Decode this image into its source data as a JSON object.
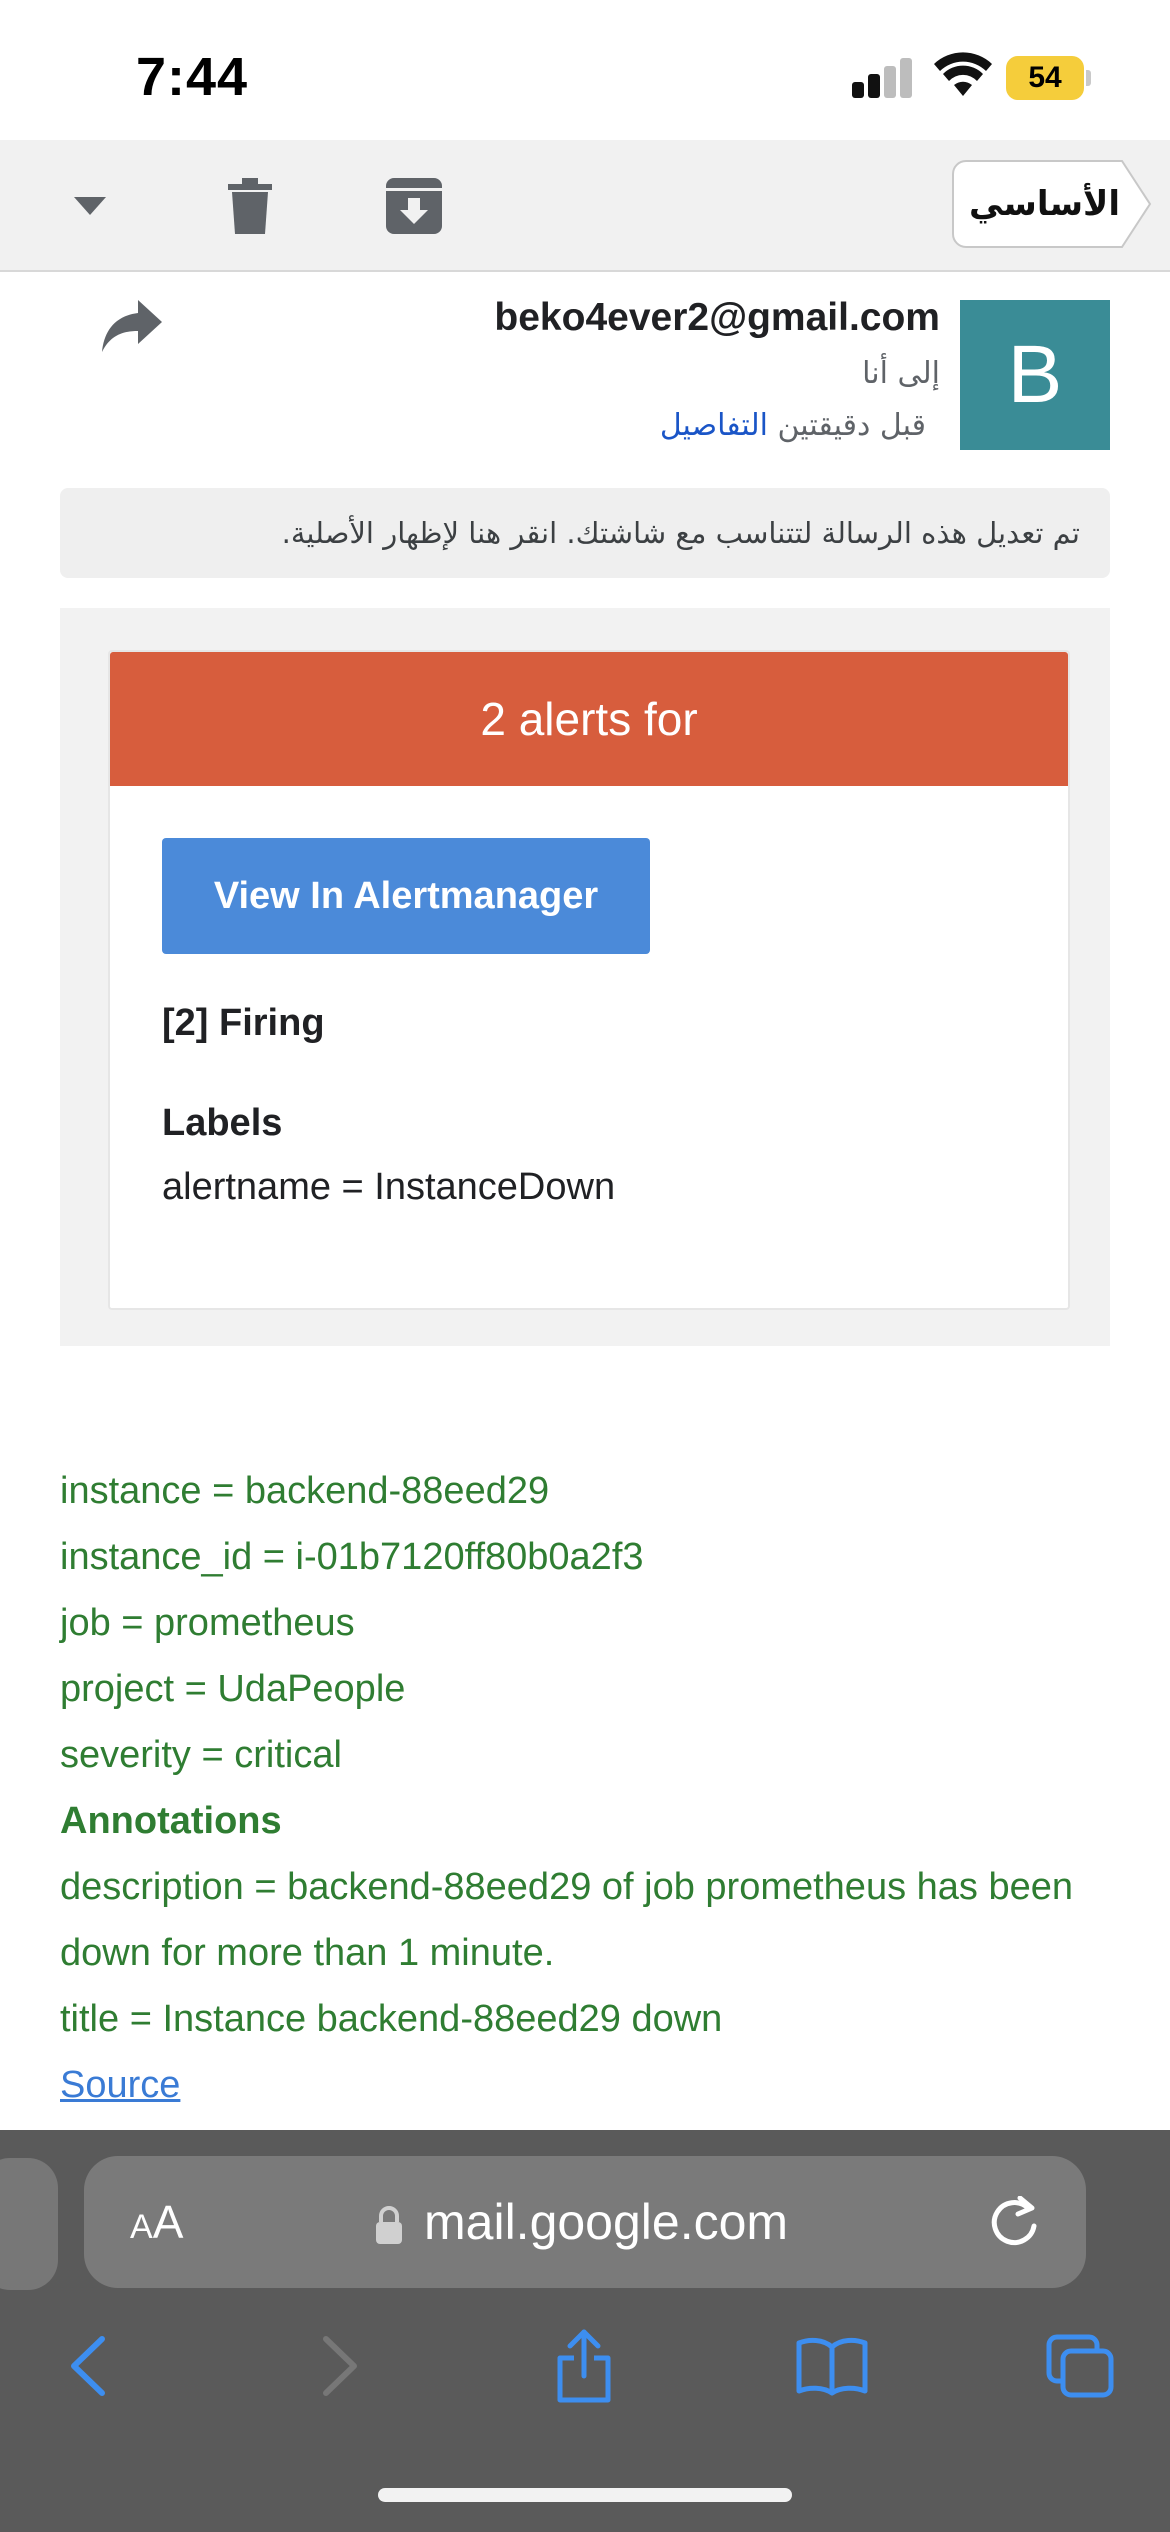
{
  "status_bar": {
    "time": "7:44",
    "battery": "54"
  },
  "toolbar": {
    "label_chip": "الأساسي"
  },
  "email": {
    "avatar_letter": "B",
    "sender": "beko4ever2@gmail.com",
    "recipient": "إلى أنا",
    "time_ago": "قبل دقيقتين",
    "details_link": "التفاصيل",
    "adjusted_notice": "تم تعديل هذه الرسالة لتتناسب مع شاشتك. انقر هنا لإظهار الأصلية."
  },
  "alert": {
    "header": "2 alerts for",
    "view_button": "View In Alertmanager",
    "firing": "[2] Firing",
    "labels_heading": "Labels",
    "alertname": "alertname = InstanceDown"
  },
  "details": {
    "instance": "instance = backend-88eed29",
    "instance_id": "instance_id = i-01b7120ff80b0a2f3",
    "job": "job = prometheus",
    "project": "project = UdaPeople",
    "severity": "severity = critical",
    "annotations_heading": "Annotations",
    "description": "description = backend-88eed29 of job prometheus has been down for more than 1 minute.",
    "title": "title = Instance backend-88eed29 down",
    "source_link": "Source"
  },
  "safari": {
    "aa_small": "A",
    "aa_big": "A",
    "url": "mail.google.com"
  },
  "colors": {
    "alert_header": "#d75d3d",
    "view_button": "#4b8ad9",
    "avatar": "#3a8c96",
    "green_text": "#2f7d32",
    "link_blue": "#1a55c7",
    "ios_blue": "#3d8ef0"
  }
}
